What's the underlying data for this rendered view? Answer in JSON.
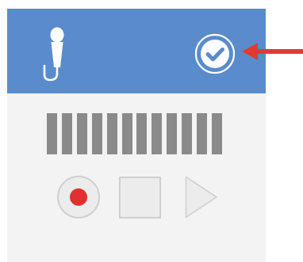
{
  "window": {
    "header_color": "#5a8ccb",
    "body_color": "#f3f3f3"
  },
  "header": {
    "mic_icon": "microphone-icon",
    "confirm_icon": "checkmark-circle-icon"
  },
  "level_meter": {
    "bar_count": 12,
    "bar_color": "#8a8a8a"
  },
  "controls": {
    "record_icon": "record-icon",
    "record_color": "#e0302f",
    "stop_icon": "stop-icon",
    "play_icon": "play-icon"
  },
  "annotation": {
    "arrow_icon": "arrow-left-icon",
    "arrow_color": "#e23b2e"
  }
}
